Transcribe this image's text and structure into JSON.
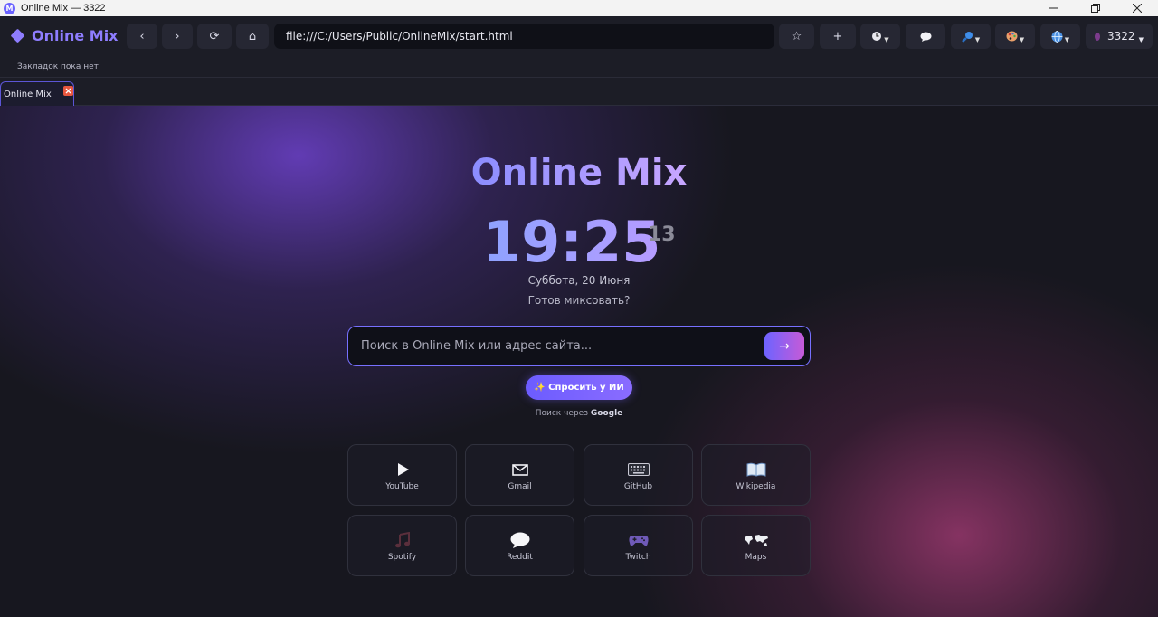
{
  "window": {
    "title": "Online Mix — 3322",
    "app_icon_letter": "M"
  },
  "toolbar": {
    "brand": "Online Mix",
    "back": "‹",
    "forward": "›",
    "reload": "⟳",
    "home": "⌂",
    "address": "file:///C:/Users/Public/OnlineMix/start.html",
    "bookmark": "☆",
    "new_tab": "+",
    "user_label": "3322"
  },
  "bookmarks_bar": {
    "empty_text": "Закладок пока нет"
  },
  "tabs": [
    {
      "label": "Online Mix"
    }
  ],
  "hero": {
    "title": "Online Mix",
    "time": "19:25",
    "seconds": "13",
    "date": "Суббота, 20 Июня",
    "greeting": "Готов миксовать?"
  },
  "search": {
    "placeholder": "Поиск в Online Mix или адрес сайта...",
    "go": "→",
    "ask_ai": "✨ Спросить у ИИ",
    "via_prefix": "Поиск через",
    "engine": "Google"
  },
  "shortcuts": [
    {
      "label": "YouTube",
      "icon": "play-icon"
    },
    {
      "label": "Gmail",
      "icon": "mail-icon"
    },
    {
      "label": "GitHub",
      "icon": "keyboard-icon"
    },
    {
      "label": "Wikipedia",
      "icon": "book-icon"
    },
    {
      "label": "Spotify",
      "icon": "music-note-icon"
    },
    {
      "label": "Reddit",
      "icon": "speech-bubble-icon"
    },
    {
      "label": "Twitch",
      "icon": "gamepad-icon"
    },
    {
      "label": "Maps",
      "icon": "world-map-icon"
    }
  ],
  "colors": {
    "accent": "#7770ff",
    "brand": "#8e7dff",
    "close": "#e8573f"
  }
}
